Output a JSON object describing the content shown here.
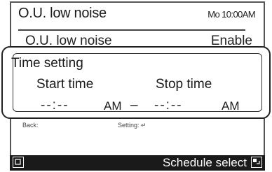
{
  "header": {
    "title": "O.U. low noise",
    "clock": "Mo 10:00AM"
  },
  "background_row": {
    "label": "O.U. low noise",
    "value": "Enable"
  },
  "popup": {
    "title": "Time setting",
    "start_label": "Start time",
    "stop_label": "Stop time",
    "start_time": "--:--",
    "start_ampm": "AM",
    "separator": "–",
    "stop_time": "--:--",
    "stop_ampm": "AM"
  },
  "hint_row": {
    "back": "Back:",
    "setting": "Setting:"
  },
  "bottom_bar": {
    "schedule_select": "Schedule select"
  },
  "icons": {
    "left_button": "left-function-button-icon",
    "right_button": "right-function-button-icon",
    "enter": "enter-arrow-icon"
  }
}
